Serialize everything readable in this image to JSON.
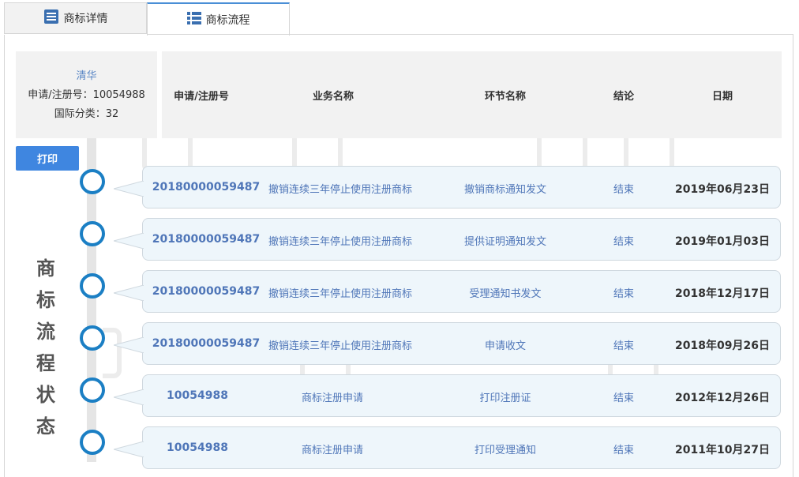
{
  "tabs": [
    {
      "label": "商标详情",
      "icon": "list-doc-icon"
    },
    {
      "label": "商标流程",
      "icon": "list-bullets-icon"
    }
  ],
  "info": {
    "name": "清华",
    "reg_line": "申请/注册号：10054988",
    "class_line": "国际分类：32"
  },
  "headers": [
    "申请/注册号",
    "业务名称",
    "环节名称",
    "结论",
    "日期"
  ],
  "print_label": "打印",
  "vertical_title": [
    "商",
    "标",
    "流",
    "程",
    "状",
    "态"
  ],
  "rows": [
    {
      "number": "20180000059487",
      "business": "撤销连续三年停止使用注册商标",
      "step": "撤销商标通知发文",
      "result": "结束",
      "date": "2019年06月23日"
    },
    {
      "number": "20180000059487",
      "business": "撤销连续三年停止使用注册商标",
      "step": "提供证明通知发文",
      "result": "结束",
      "date": "2019年01月03日"
    },
    {
      "number": "20180000059487",
      "business": "撤销连续三年停止使用注册商标",
      "step": "受理通知书发文",
      "result": "结束",
      "date": "2018年12月17日"
    },
    {
      "number": "20180000059487",
      "business": "撤销连续三年停止使用注册商标",
      "step": "申请收文",
      "result": "结束",
      "date": "2018年09月26日"
    },
    {
      "number": "10054988",
      "business": "商标注册申请",
      "step": "打印注册证",
      "result": "结束",
      "date": "2012年12月26日"
    },
    {
      "number": "10054988",
      "business": "商标注册申请",
      "step": "打印受理通知",
      "result": "结束",
      "date": "2011年10月27日"
    }
  ]
}
